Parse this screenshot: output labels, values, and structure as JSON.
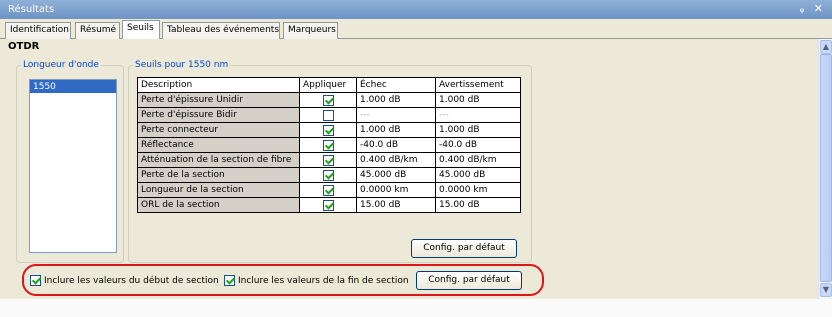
{
  "window": {
    "title": "Résultats",
    "buttons": "ᵩ ✕"
  },
  "tabs": [
    {
      "label": "Identification",
      "active": false
    },
    {
      "label": "Résumé",
      "active": false
    },
    {
      "label": "Seuils",
      "active": true
    },
    {
      "label": "Tableau des événements",
      "active": false
    },
    {
      "label": "Marqueurs",
      "active": false
    }
  ],
  "section_title": "OTDR",
  "wavelength": {
    "legend": "Longueur d'onde",
    "items": [
      "1550"
    ],
    "selected": "1550"
  },
  "thresholds": {
    "legend": "Seuils pour 1550 nm",
    "columns": [
      "Description",
      "Appliquer",
      "Échec",
      "Avertissement"
    ],
    "rows": [
      {
        "description": "Perte d'épissure Unidir",
        "apply": true,
        "fail": "1.000 dB",
        "warning": "1.000 dB"
      },
      {
        "description": "Perte d'épissure Bidir",
        "apply": false,
        "fail": "---",
        "warning": "---"
      },
      {
        "description": "Perte connecteur",
        "apply": true,
        "fail": "1.000 dB",
        "warning": "1.000 dB"
      },
      {
        "description": "Réflectance",
        "apply": true,
        "fail": "-40.0 dB",
        "warning": "-40.0 dB"
      },
      {
        "description": "Atténuation de la section de fibre",
        "apply": true,
        "fail": "0.400 dB/km",
        "warning": "0.400 dB/km"
      },
      {
        "description": "Perte de la section",
        "apply": true,
        "fail": "45.000 dB",
        "warning": "45.000 dB"
      },
      {
        "description": "Longueur de la section",
        "apply": true,
        "fail": "0.0000 km",
        "warning": "0.0000 km"
      },
      {
        "description": "ORL de la section",
        "apply": true,
        "fail": "15.00 dB",
        "warning": "15.00 dB"
      }
    ],
    "default_button": "Config. par défaut"
  },
  "options": {
    "include_start": {
      "label": "Inclure les valeurs du début de section",
      "checked": true
    },
    "include_end": {
      "label": "Inclure les valeurs de la fin de section",
      "checked": true
    },
    "default_button": "Config. par défaut"
  },
  "colors": {
    "highlight_oval": "#e0141b",
    "selection": "#316ac5",
    "legend": "#0046d5"
  }
}
